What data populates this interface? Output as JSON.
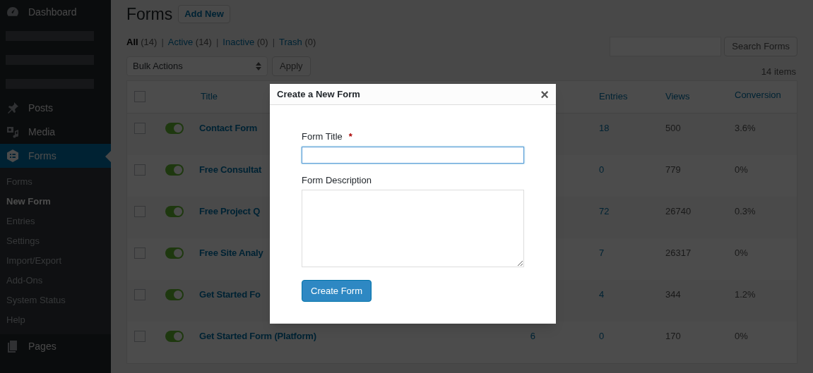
{
  "sidebar": {
    "items": [
      {
        "kind": "item",
        "label": "Dashboard",
        "selected": false
      },
      {
        "kind": "blurred"
      },
      {
        "kind": "blurred"
      },
      {
        "kind": "blurred"
      },
      {
        "kind": "item",
        "label": "Posts",
        "selected": false
      },
      {
        "kind": "item",
        "label": "Media",
        "selected": false
      },
      {
        "kind": "item",
        "label": "Forms",
        "selected": true,
        "submenu": [
          {
            "label": "Forms",
            "selected": false
          },
          {
            "label": "New Form",
            "selected": true
          },
          {
            "label": "Entries",
            "selected": false
          },
          {
            "label": "Settings",
            "selected": false
          },
          {
            "label": "Import/Export",
            "selected": false
          },
          {
            "label": "Add-Ons",
            "selected": false
          },
          {
            "label": "System Status",
            "selected": false
          },
          {
            "label": "Help",
            "selected": false
          }
        ]
      },
      {
        "kind": "item",
        "label": "Pages",
        "selected": false
      }
    ]
  },
  "page": {
    "title": "Forms",
    "add_new": "Add New",
    "filters": [
      {
        "label": "All",
        "count": "(14)",
        "selected": true
      },
      {
        "label": "Active",
        "count": "(14)",
        "selected": false
      },
      {
        "label": "Inactive",
        "count": "(0)",
        "selected": false
      },
      {
        "label": "Trash",
        "count": "(0)",
        "selected": false
      }
    ],
    "separator": "|",
    "search_button": "Search Forms",
    "bulk_actions": "Bulk Actions",
    "apply": "Apply",
    "item_count": "14 items"
  },
  "table": {
    "all_checked": false,
    "columns": {
      "title": "Title",
      "entries": "Entries",
      "views": "Views",
      "conversion": "Conversion"
    },
    "rows": [
      {
        "checked": false,
        "on": true,
        "title": "Contact Form",
        "entries": "18",
        "views": "500",
        "conversion": "3.6%"
      },
      {
        "checked": false,
        "on": true,
        "title": "Free Consultat",
        "entries": "0",
        "views": "779",
        "conversion": "0%"
      },
      {
        "checked": false,
        "on": true,
        "title": "Free Project Q",
        "entries": "72",
        "views": "26740",
        "conversion": "0.3%"
      },
      {
        "checked": false,
        "on": true,
        "title": "Free Site Analy",
        "entries": "7",
        "views": "26317",
        "conversion": "0%"
      },
      {
        "checked": false,
        "on": true,
        "title": "Get Started Fo",
        "entries": "4",
        "views": "344",
        "conversion": "1.2%"
      },
      {
        "checked": false,
        "on": true,
        "title": "Get Started Form (Platform)",
        "column_3": "6",
        "entries": "0",
        "views": "170",
        "conversion": "0%"
      }
    ]
  },
  "dialog": {
    "title": "Create a New Form",
    "close": "×",
    "title_label": "Form Title",
    "required_mark": "*",
    "description_label": "Form Description",
    "submit": "Create Form"
  }
}
